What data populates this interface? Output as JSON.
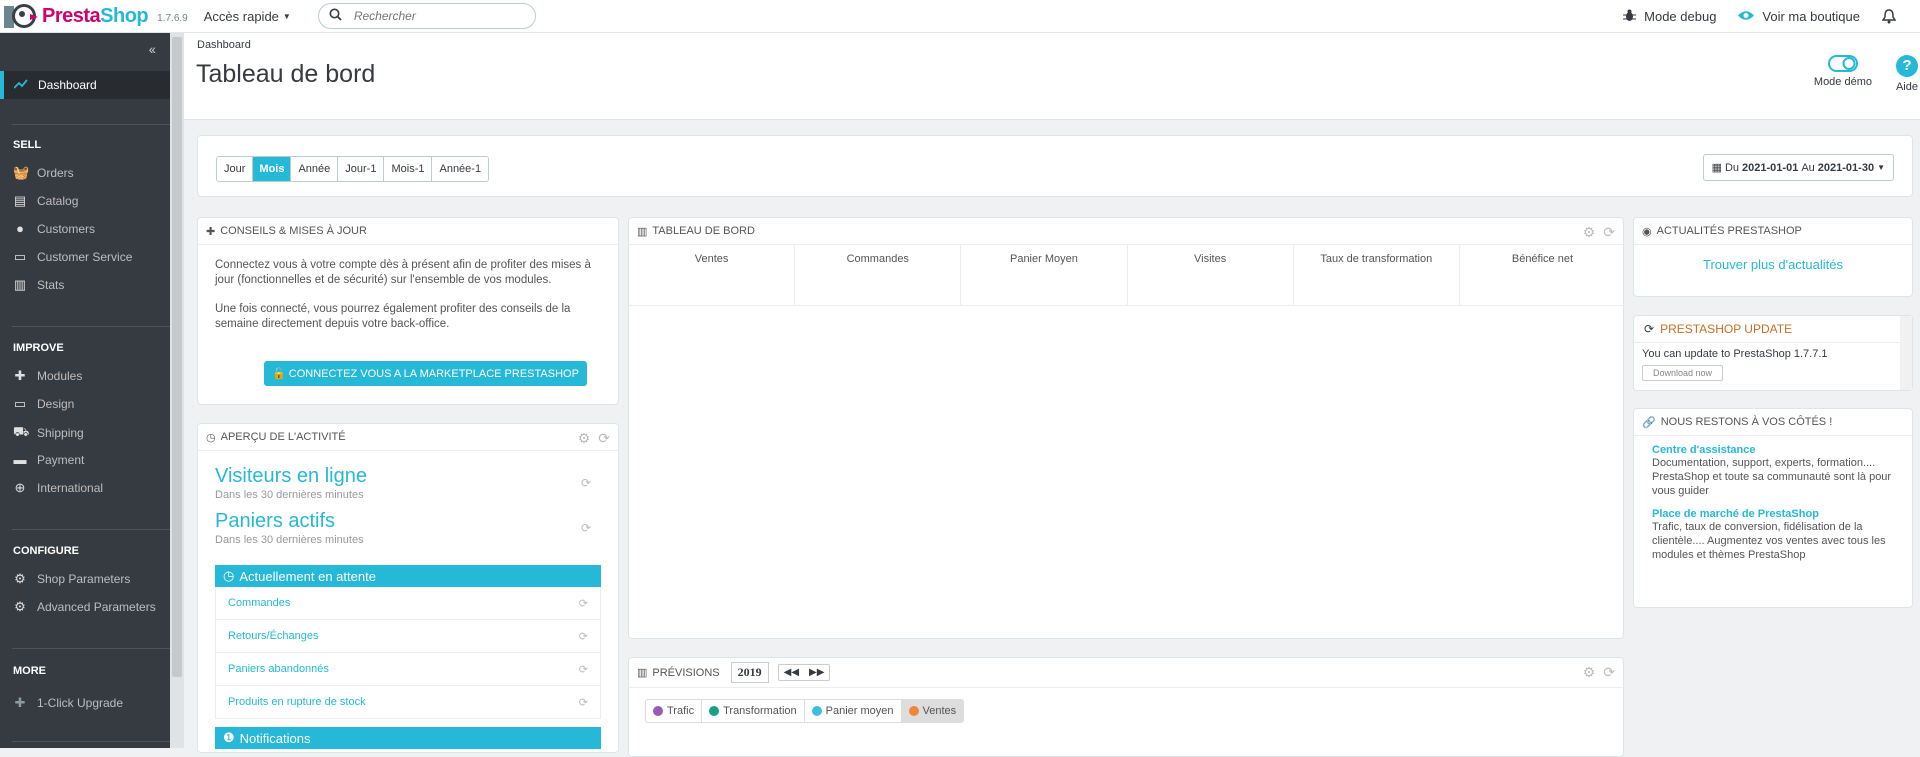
{
  "topbar": {
    "brand_presta": "Presta",
    "brand_shop": "Shop",
    "version": "1.7.6.9",
    "quick_access": "Accès rapide",
    "search_placeholder": "Rechercher",
    "debug_mode": "Mode debug",
    "view_shop": "Voir ma boutique"
  },
  "sidebar": {
    "active_item": "Dashboard",
    "sections": [
      {
        "title": "SELL",
        "items": [
          "Orders",
          "Catalog",
          "Customers",
          "Customer Service",
          "Stats"
        ]
      },
      {
        "title": "IMPROVE",
        "items": [
          "Modules",
          "Design",
          "Shipping",
          "Payment",
          "International"
        ]
      },
      {
        "title": "CONFIGURE",
        "items": [
          "Shop Parameters",
          "Advanced Parameters"
        ]
      },
      {
        "title": "MORE",
        "items": [
          "1-Click Upgrade"
        ]
      }
    ]
  },
  "header": {
    "breadcrumb": "Dashboard",
    "title": "Tableau de bord",
    "demo_mode": "Mode démo",
    "help": "Aide"
  },
  "period": {
    "buttons": [
      "Jour",
      "Mois",
      "Année",
      "Jour-1",
      "Mois-1",
      "Année-1"
    ],
    "active": "Mois",
    "date_from_label": "Du",
    "date_from": "2021-01-01",
    "date_to_label": "Au",
    "date_to": "2021-01-30"
  },
  "conseils": {
    "title": "CONSEILS & MISES À JOUR",
    "text1": "Connectez vous à votre compte dès à présent afin de profiter des mises à jour (fonctionnelles et de sécurité) sur l'ensemble de vos modules.",
    "text2": "Une fois connecté, vous pourrez également profiter des conseils de la semaine directement depuis votre back-office.",
    "button": "CONNECTEZ VOUS A LA MARKETPLACE PRESTASHOP"
  },
  "activity": {
    "title": "APERÇU DE L'ACTIVITÉ",
    "visitors_title": "Visiteurs en ligne",
    "visitors_sub": "Dans les 30 dernières minutes",
    "carts_title": "Paniers actifs",
    "carts_sub": "Dans les 30 dernières minutes",
    "pending_title": "Actuellement en attente",
    "pending_items": [
      "Commandes",
      "Retours/Échanges",
      "Paniers abandonnés",
      "Produits en rupture de stock"
    ],
    "notifications_title": "Notifications"
  },
  "dashboard": {
    "title": "TABLEAU DE BORD",
    "columns": [
      "Ventes",
      "Commandes",
      "Panier Moyen",
      "Visites",
      "Taux de transformation",
      "Bénéfice net"
    ]
  },
  "forecast": {
    "title": "PRÉVISIONS",
    "year": "2019",
    "legend": [
      {
        "label": "Trafic",
        "color": "#9b59b6"
      },
      {
        "label": "Transformation",
        "color": "#16a085"
      },
      {
        "label": "Panier moyen",
        "color": "#3dc0e0"
      },
      {
        "label": "Ventes",
        "color": "#f0863a"
      }
    ]
  },
  "news": {
    "title": "ACTUALITÉS PRESTASHOP",
    "link": "Trouver plus d'actualités"
  },
  "update": {
    "title": "PRESTASHOP UPDATE",
    "text": "You can update to PrestaShop 1.7.7.1",
    "button": "Download now"
  },
  "help_panel": {
    "title": "NOUS RESTONS À VOS CÔTÉS !",
    "items": [
      {
        "link": "Centre d'assistance",
        "text": "Documentation, support, experts, formation.... PrestaShop et toute sa communauté sont là pour vous guider"
      },
      {
        "link": "Place de marché de PrestaShop",
        "text": "Trafic, taux de conversion, fidélisation de la clientèle.... Augmentez vos ventes avec tous les modules et thèmes PrestaShop"
      }
    ]
  }
}
